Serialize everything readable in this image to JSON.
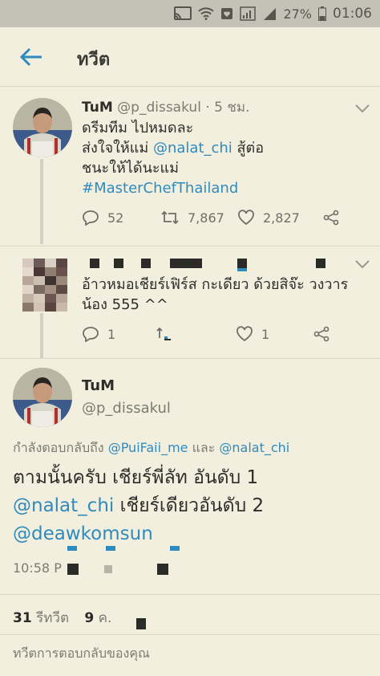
{
  "status_bar": {
    "battery": "27%",
    "time": "01:06"
  },
  "app_bar": {
    "title": "ทวีต"
  },
  "tweet1": {
    "name": "TuM",
    "handle": "@p_dissakul",
    "time": "· 5 ชม.",
    "line1": "ดรีมทีม ไปหมดละ",
    "line2_prefix": "ส่งใจให้แม่ ",
    "line2_mention": "@nalat_chi",
    "line2_suffix": " สู้ต่อ",
    "line3": "ชนะให้ได้นะแม่",
    "line4": "#MasterChefThailand",
    "replies": "52",
    "retweets": "7,867",
    "likes": "2,827"
  },
  "tweet2": {
    "line1": "อ้าวหมอเชียร์เฟิร์ส กะเดียว ด้วยสิจ๊ะ วงวาร",
    "line2": "น้อง 555 ^^",
    "replies": "1",
    "likes": "1"
  },
  "main_tweet": {
    "name": "TuM",
    "handle": "@p_dissakul",
    "reply_prefix": "กำลังตอบกลับถึง ",
    "reply_user1": "@PuiFaii_me",
    "reply_and": " และ ",
    "reply_user2": "@nalat_chi",
    "text1": "ตามนั้นครับ เชียร์พี่ลัท อันดับ 1",
    "text2_mention": "@nalat_chi",
    "text2_rest": " เชียร์เดียวอันดับ 2",
    "text3_mention": "@deawkomsun",
    "time": "10:58 P",
    "retweet_count": "31",
    "retweet_label": "รีทวีต",
    "like_count": "9",
    "like_label": "ค."
  },
  "reply_box": {
    "placeholder": "ทวีตการตอบกลับของคุณ"
  },
  "colors": {
    "accent": "#2f8bbd",
    "background": "#f2efdf",
    "status_bar": "#c4c2b6"
  }
}
